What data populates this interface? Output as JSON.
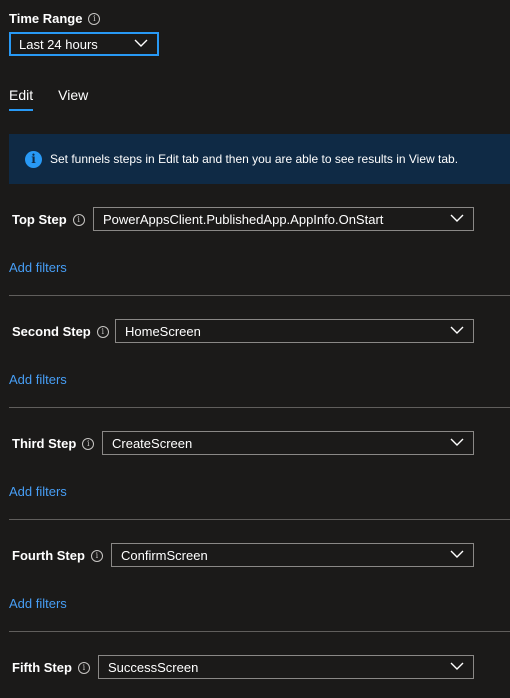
{
  "time_range": {
    "label": "Time Range",
    "selected": "Last 24 hours"
  },
  "tabs": [
    {
      "label": "Edit",
      "active": true
    },
    {
      "label": "View",
      "active": false
    }
  ],
  "info_banner": {
    "text": "Set funnels steps in Edit tab and then you are able to see results in View tab."
  },
  "steps": [
    {
      "label": "Top Step",
      "value": "PowerAppsClient.PublishedApp.AppInfo.OnStart",
      "add_filters": "Add filters"
    },
    {
      "label": "Second Step",
      "value": "HomeScreen",
      "add_filters": "Add filters"
    },
    {
      "label": "Third Step",
      "value": "CreateScreen",
      "add_filters": "Add filters"
    },
    {
      "label": "Fourth Step",
      "value": "ConfirmScreen",
      "add_filters": "Add filters"
    },
    {
      "label": "Fifth Step",
      "value": "SuccessScreen"
    }
  ],
  "colors": {
    "background": "#1b1a19",
    "accent": "#2899f5",
    "link": "#479ef5",
    "banner_bg": "#0f2a45",
    "border": "#8a8886"
  }
}
